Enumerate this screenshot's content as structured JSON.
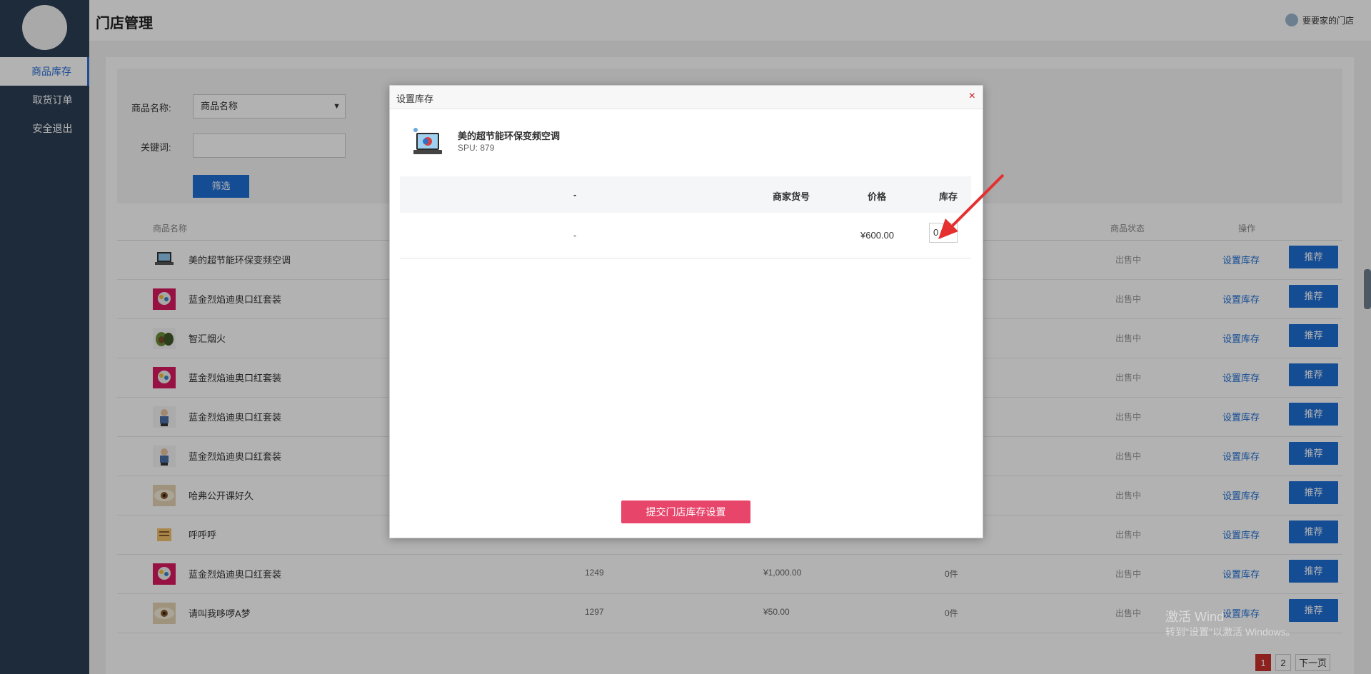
{
  "sidebar": {
    "items": [
      {
        "label": "商品库存",
        "active": true
      },
      {
        "label": "取货订单",
        "active": false
      },
      {
        "label": "安全退出",
        "active": false
      }
    ]
  },
  "header": {
    "title": "门店管理",
    "shop_name": "要要家的门店"
  },
  "filter": {
    "name_label": "商品名称:",
    "name_select_value": "商品名称",
    "keyword_label": "关键词:",
    "keyword_value": "",
    "submit_label": "筛选"
  },
  "table": {
    "columns": {
      "name": "商品名称",
      "status": "商品状态",
      "actions": "操作"
    },
    "rows": [
      {
        "name": "美的超节能环保变频空调",
        "spu": "",
        "price": "",
        "stock": "",
        "status": "出售中",
        "set_label": "设置库存",
        "rec_label": "推荐",
        "thumb": "laptop"
      },
      {
        "name": "蓝金烈焰迪奥口红套装",
        "spu": "",
        "price": "",
        "stock": "",
        "status": "出售中",
        "set_label": "设置库存",
        "rec_label": "推荐",
        "thumb": "red"
      },
      {
        "name": "智汇烟火",
        "spu": "",
        "price": "",
        "stock": "",
        "status": "出售中",
        "set_label": "设置库存",
        "rec_label": "推荐",
        "thumb": "avocado"
      },
      {
        "name": "蓝金烈焰迪奥口红套装",
        "spu": "",
        "price": "",
        "stock": "",
        "status": "出售中",
        "set_label": "设置库存",
        "rec_label": "推荐",
        "thumb": "red"
      },
      {
        "name": "蓝金烈焰迪奥口红套装",
        "spu": "",
        "price": "",
        "stock": "",
        "status": "出售中",
        "set_label": "设置库存",
        "rec_label": "推荐",
        "thumb": "figure"
      },
      {
        "name": "蓝金烈焰迪奥口红套装",
        "spu": "",
        "price": "",
        "stock": "",
        "status": "出售中",
        "set_label": "设置库存",
        "rec_label": "推荐",
        "thumb": "figure"
      },
      {
        "name": "哈弗公开课好久",
        "spu": "",
        "price": "",
        "stock": "",
        "status": "出售中",
        "set_label": "设置库存",
        "rec_label": "推荐",
        "thumb": "eye"
      },
      {
        "name": "呼呼呼",
        "spu": "",
        "price": "",
        "stock": "",
        "status": "出售中",
        "set_label": "设置库存",
        "rec_label": "推荐",
        "thumb": "label"
      },
      {
        "name": "蓝金烈焰迪奥口红套装",
        "spu": "1249",
        "price": "¥1,000.00",
        "stock": "0件",
        "status": "出售中",
        "set_label": "设置库存",
        "rec_label": "推荐",
        "thumb": "red"
      },
      {
        "name": "请叫我哆啰A梦",
        "spu": "1297",
        "price": "¥50.00",
        "stock": "0件",
        "status": "出售中",
        "set_label": "设置库存",
        "rec_label": "推荐",
        "thumb": "eye"
      }
    ]
  },
  "pager": {
    "page1": "1",
    "page2": "2",
    "next": "下一页"
  },
  "watermark": {
    "line1": "激活 Wind",
    "line2": "转到\"设置\"以激活 Windows。"
  },
  "modal": {
    "title": "设置库存",
    "close": "×",
    "product_title": "美的超节能环保变频空调",
    "product_spu": "SPU: 879",
    "columns": {
      "spec": "-",
      "sku": "商家货号",
      "price": "价格",
      "stock": "库存"
    },
    "row": {
      "spec": "-",
      "sku": "",
      "price": "¥600.00",
      "stock": "0"
    },
    "submit_label": "提交门店库存设置"
  },
  "colors": {
    "sidebar": "#2b3e55",
    "primary": "#1f6fd6",
    "submit": "#e8456b",
    "arrow": "#e53030",
    "close": "#d01818"
  }
}
